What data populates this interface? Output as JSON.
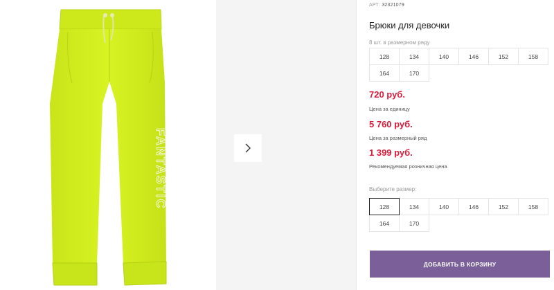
{
  "product": {
    "sku_label": "АРТ:",
    "sku": "32321079",
    "title": "Брюки для девочки",
    "image_icon": "pants-image",
    "brand_text_on_image": "FANTASTIC"
  },
  "size_row": {
    "note": "8 шт. в размерном ряду",
    "sizes": [
      "128",
      "134",
      "140",
      "146",
      "152",
      "158",
      "164",
      "170"
    ]
  },
  "prices": {
    "unit_price": "720 руб.",
    "unit_label": "Цена за единицу",
    "row_price": "5 760 руб.",
    "row_label": "Цена за размерный ряд",
    "retail_price": "1 399 руб.",
    "retail_label": "Рекомендуемая розничная цена"
  },
  "size_select": {
    "label": "Выберите размер:",
    "selected": "128",
    "sizes": [
      "128",
      "134",
      "140",
      "146",
      "152",
      "158",
      "164",
      "170"
    ]
  },
  "actions": {
    "add_to_cart": "ДОБАВИТЬ В КОРЗИНУ",
    "next_icon": "chevron-right-icon"
  },
  "colors": {
    "price": "#d81d3b",
    "button": "#7a5f99",
    "product": "#d4ef1b"
  }
}
